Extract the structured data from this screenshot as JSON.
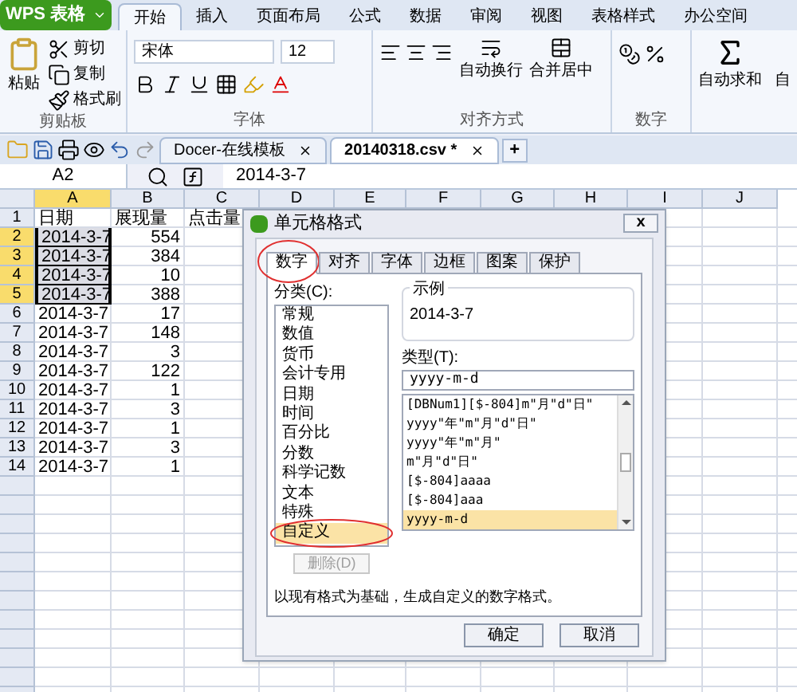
{
  "app_button": "WPS 表格",
  "ribbon_tabs": [
    {
      "label": "开始",
      "selected": true
    },
    {
      "label": "插入",
      "selected": false
    },
    {
      "label": "页面布局",
      "selected": false
    },
    {
      "label": "公式",
      "selected": false
    },
    {
      "label": "数据",
      "selected": false
    },
    {
      "label": "审阅",
      "selected": false
    },
    {
      "label": "视图",
      "selected": false
    },
    {
      "label": "表格样式",
      "selected": false
    },
    {
      "label": "办公空间",
      "selected": false
    }
  ],
  "clipboard": {
    "title": "剪贴板",
    "paste": "粘贴",
    "cut": "剪切",
    "copy": "复制",
    "format_painter": "格式刷"
  },
  "font": {
    "title": "字体",
    "font_name": "宋体",
    "font_size": "12"
  },
  "alignment": {
    "title": "对齐方式",
    "wrap": "自动换行",
    "merge": "合并居中"
  },
  "number": {
    "title": "数字"
  },
  "autosum": {
    "label": "自动求和"
  },
  "cut_off_label": "自",
  "doc_tabs": [
    {
      "label": "Docer-在线模板",
      "selected": false
    },
    {
      "label": "20140318.csv *",
      "selected": true
    }
  ],
  "new_tab": "+",
  "name_box": "A2",
  "formula": "2014-3-7",
  "columns": [
    {
      "label": "A",
      "selected": true
    },
    {
      "label": "B",
      "selected": false
    },
    {
      "label": "C",
      "selected": false
    },
    {
      "label": "D",
      "selected": false
    },
    {
      "label": "E",
      "selected": false
    },
    {
      "label": "F",
      "selected": false
    },
    {
      "label": "G",
      "selected": false
    },
    {
      "label": "H",
      "selected": false
    },
    {
      "label": "I",
      "selected": false
    },
    {
      "label": "J",
      "selected": false
    }
  ],
  "rows": [
    {
      "number": "1",
      "selected": false,
      "cells": [
        "日期",
        "展现量",
        "点击量"
      ]
    },
    {
      "number": "2",
      "selected": true,
      "cells": [
        "2014-3-7",
        "554"
      ]
    },
    {
      "number": "3",
      "selected": true,
      "cells": [
        "2014-3-7",
        "384"
      ]
    },
    {
      "number": "4",
      "selected": true,
      "cells": [
        "2014-3-7",
        "10"
      ]
    },
    {
      "number": "5",
      "selected": true,
      "cells": [
        "2014-3-7",
        "388"
      ]
    },
    {
      "number": "6",
      "selected": false,
      "cells": [
        "2014-3-7",
        "17"
      ]
    },
    {
      "number": "7",
      "selected": false,
      "cells": [
        "2014-3-7",
        "148"
      ]
    },
    {
      "number": "8",
      "selected": false,
      "cells": [
        "2014-3-7",
        "3"
      ]
    },
    {
      "number": "9",
      "selected": false,
      "cells": [
        "2014-3-7",
        "122"
      ]
    },
    {
      "number": "10",
      "selected": false,
      "cells": [
        "2014-3-7",
        "1"
      ]
    },
    {
      "number": "11",
      "selected": false,
      "cells": [
        "2014-3-7",
        "3"
      ]
    },
    {
      "number": "12",
      "selected": false,
      "cells": [
        "2014-3-7",
        "1"
      ]
    },
    {
      "number": "13",
      "selected": false,
      "cells": [
        "2014-3-7",
        "3"
      ]
    },
    {
      "number": "14",
      "selected": false,
      "cells": [
        "2014-3-7",
        "1"
      ]
    }
  ],
  "dialog": {
    "title": "单元格格式",
    "close": "x",
    "tabs": [
      {
        "label": "数字",
        "selected": true,
        "circled": true
      },
      {
        "label": "对齐",
        "selected": false,
        "circled": false
      },
      {
        "label": "字体",
        "selected": false,
        "circled": false
      },
      {
        "label": "边框",
        "selected": false,
        "circled": false
      },
      {
        "label": "图案",
        "selected": false,
        "circled": false
      },
      {
        "label": "保护",
        "selected": false,
        "circled": false
      }
    ],
    "category_label": "分类(C):",
    "categories": [
      {
        "label": "常规",
        "selected": false,
        "circled": false
      },
      {
        "label": "数值",
        "selected": false,
        "circled": false
      },
      {
        "label": "货币",
        "selected": false,
        "circled": false
      },
      {
        "label": "会计专用",
        "selected": false,
        "circled": false
      },
      {
        "label": "日期",
        "selected": false,
        "circled": false
      },
      {
        "label": "时间",
        "selected": false,
        "circled": false
      },
      {
        "label": "百分比",
        "selected": false,
        "circled": false
      },
      {
        "label": "分数",
        "selected": false,
        "circled": false
      },
      {
        "label": "科学记数",
        "selected": false,
        "circled": false
      },
      {
        "label": "文本",
        "selected": false,
        "circled": false
      },
      {
        "label": "特殊",
        "selected": false,
        "circled": false
      },
      {
        "label": "自定义",
        "selected": true,
        "circled": true
      }
    ],
    "sample_label": "示例",
    "sample": "2014-3-7",
    "type_label": "类型(T):",
    "type_value": "yyyy-m-d",
    "types": [
      {
        "label": "[DBNum1][$-804]m\"月\"d\"日\"",
        "selected": false
      },
      {
        "label": "yyyy\"年\"m\"月\"d\"日\"",
        "selected": false
      },
      {
        "label": "yyyy\"年\"m\"月\"",
        "selected": false
      },
      {
        "label": "m\"月\"d\"日\"",
        "selected": false
      },
      {
        "label": "[$-804]aaaa",
        "selected": false
      },
      {
        "label": "[$-804]aaa",
        "selected": false
      },
      {
        "label": "yyyy-m-d",
        "selected": true
      }
    ],
    "delete_button": {
      "label": "删除(D)",
      "disabled": true
    },
    "description": "以现有格式为基础，生成自定义的数字格式。",
    "ok": "确定",
    "cancel": "取消"
  }
}
